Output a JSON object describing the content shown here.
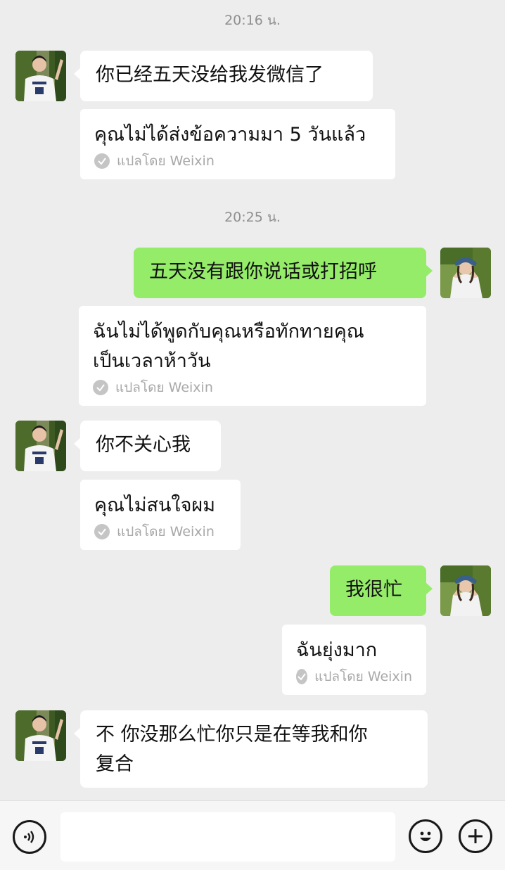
{
  "messages": [
    {
      "time": "20:16 น."
    },
    {
      "original": "你已经五天没给我发微信了",
      "translation": "คุณไม่ได้ส่งข้อความมา 5 วันแล้ว",
      "via": "แปลโดย Weixin"
    },
    {
      "time": "20:25 น."
    },
    {
      "original": "五天没有跟你说话或打招呼",
      "translation_lines": [
        "ฉันไม่ได้พูดกับคุณหรือทักทายคุณ",
        "เป็นเวลาห้าวัน"
      ],
      "via": "แปลโดย Weixin"
    },
    {
      "original": "你不关心我",
      "translation": "คุณไม่สนใจผม",
      "via": "แปลโดย Weixin"
    },
    {
      "original": "我很忙",
      "translation": "ฉันยุ่งมาก",
      "via": "แปลโดย Weixin"
    },
    {
      "original_lines": [
        "不 你没那么忙你只是在等我和你",
        "复合"
      ]
    }
  ],
  "input": {
    "value": ""
  },
  "icons": {
    "voice": "voice-icon",
    "emoji": "emoji-icon",
    "plus": "plus-icon"
  },
  "colors": {
    "background": "#ededed",
    "outgoing_bubble": "#95ec69",
    "incoming_bubble": "#ffffff",
    "timestamp": "#8f8f8f"
  }
}
